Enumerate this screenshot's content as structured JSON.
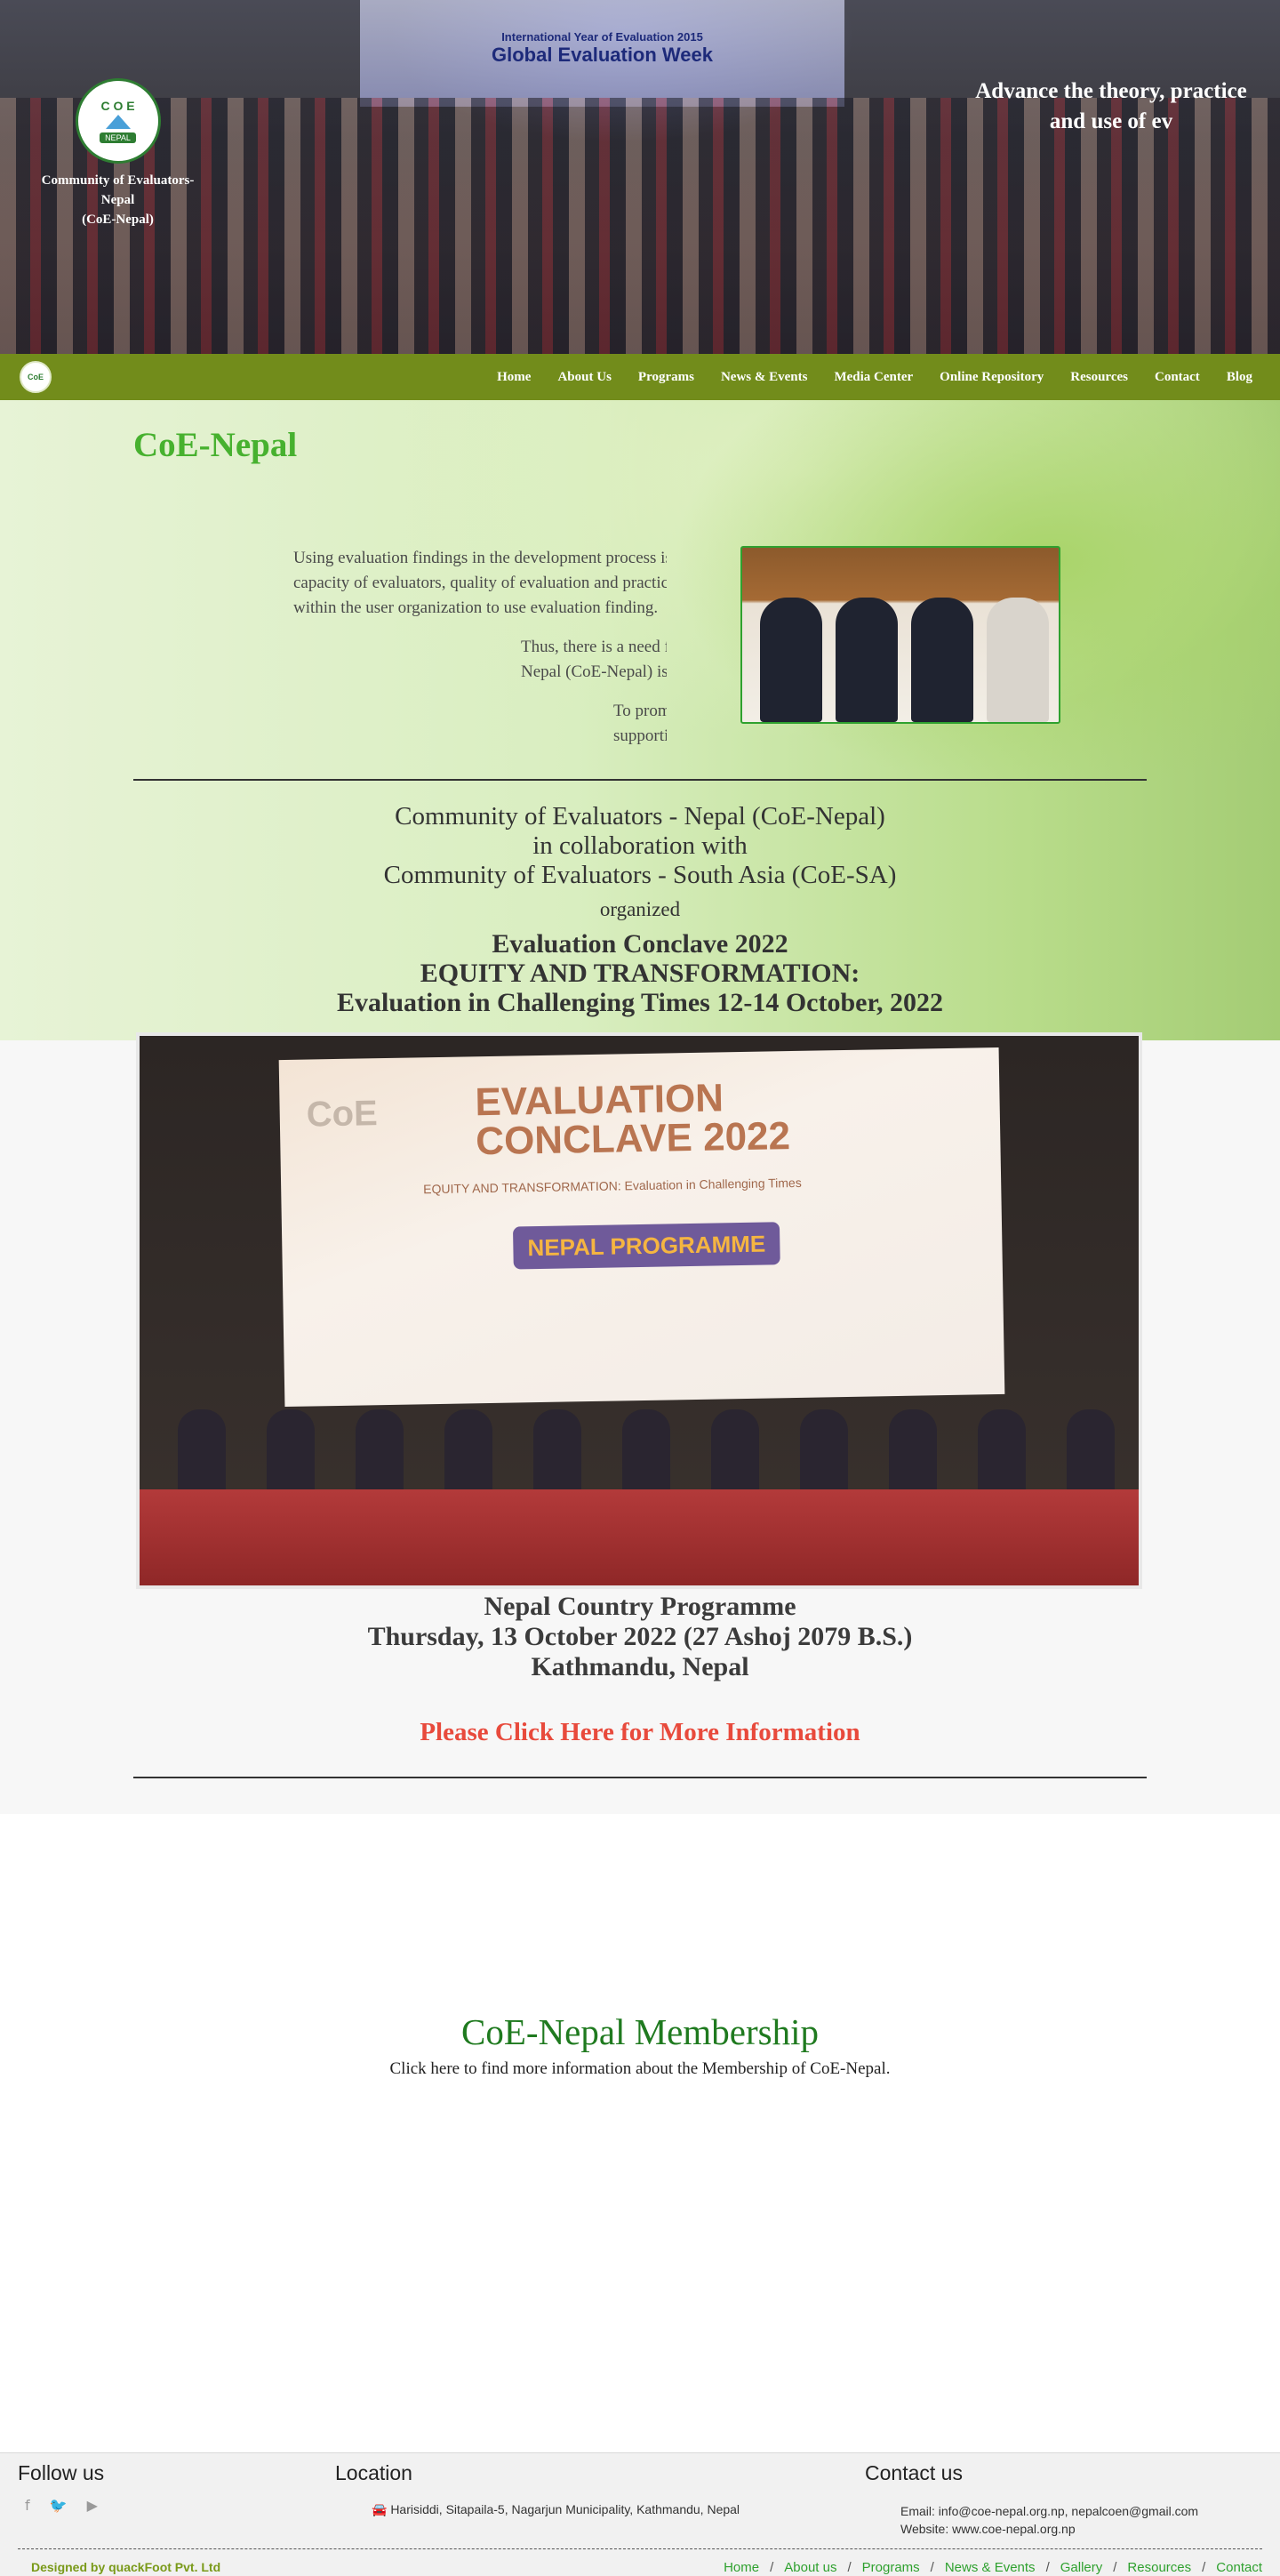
{
  "hero": {
    "banner_line1": "International Year of Evaluation 2015",
    "banner_line2": "Global Evaluation Week",
    "logo_text": "C O E",
    "logo_sub": "NEPAL",
    "org_name_line1": "Community of Evaluators-",
    "org_name_line2": "Nepal",
    "org_name_line3": "(CoE-Nepal)",
    "tagline_line1": "Advance the theory, practice",
    "tagline_line2": "and use of ev"
  },
  "nav": {
    "logo_text": "CoE",
    "items": [
      "Home",
      "About Us",
      "Programs",
      "News & Events",
      "Media Center",
      "Online Repository",
      "Resources",
      "Contact",
      "Blog"
    ]
  },
  "main": {
    "title": "CoE-Nepal",
    "intro_p1": "Using evaluation findings in the development process is a c capacity of evaluators, quality of evaluation and practicality within the user organization to use evaluation finding.",
    "intro_p1_l1": "Using evaluation findings in the development process is a c",
    "intro_p1_l2": "capacity of evaluators, quality of evaluation and practicality",
    "intro_p1_l3": "within the user organization to use evaluation finding.",
    "intro_p2_l1": "Thus, there is a need for ca",
    "intro_p2_l2": "Nepal (CoE-Nepal) is comi",
    "intro_p3_l1": "To promote ev",
    "intro_p3_l2": "supporting for",
    "collab_l1": "Community of Evaluators - Nepal (CoE-Nepal)",
    "collab_l2": "in collaboration with",
    "collab_l3": "Community of Evaluators - South Asia (CoE-SA)",
    "collab_l4": "organized",
    "event_l1": "Evaluation Conclave 2022",
    "event_l2": "EQUITY AND TRANSFORMATION:",
    "event_l3": "Evaluation in Challenging Times 12-14 October, 2022"
  },
  "conclave_photo": {
    "banner_title_1": "EVALUATION",
    "banner_title_2": "CONCLAVE 2022",
    "banner_subtitle": "EQUITY AND TRANSFORMATION: Evaluation in Challenging Times",
    "banner_programme": "NEPAL PROGRAMME",
    "banner_logo": "CoE"
  },
  "programme": {
    "line1": "Nepal Country Programme",
    "line2": "Thursday, 13 October 2022 (27 Ashoj 2079 B.S.)",
    "line3": "Kathmandu, Nepal",
    "more_link": "Please Click Here for More Information"
  },
  "membership": {
    "title": "CoE-Nepal Membership",
    "text": "Click here to find more information about the Membership of CoE-Nepal."
  },
  "footer": {
    "follow_title": "Follow us",
    "social": [
      "f",
      "🐦",
      "▶"
    ],
    "location_title": "Location",
    "location_text": "🚘 Harisiddi, Sitapaila-5, Nagarjun Municipality, Kathmandu, Nepal",
    "contact_title": "Contact us",
    "email": "Email: info@coe-nepal.org.np, nepalcoen@gmail.com",
    "website": "Website: www.coe-nepal.org.np",
    "designed_by": "Designed by quackFoot Pvt. Ltd",
    "links": [
      "Home",
      "About us",
      "Programs",
      "News & Events",
      "Gallery",
      "Resources",
      "Contact"
    ]
  },
  "colors": {
    "nav_bg": "#728c1b",
    "title_green": "#47b12f",
    "link_red": "#e84a3c",
    "membership_green": "#1f7a1f"
  }
}
